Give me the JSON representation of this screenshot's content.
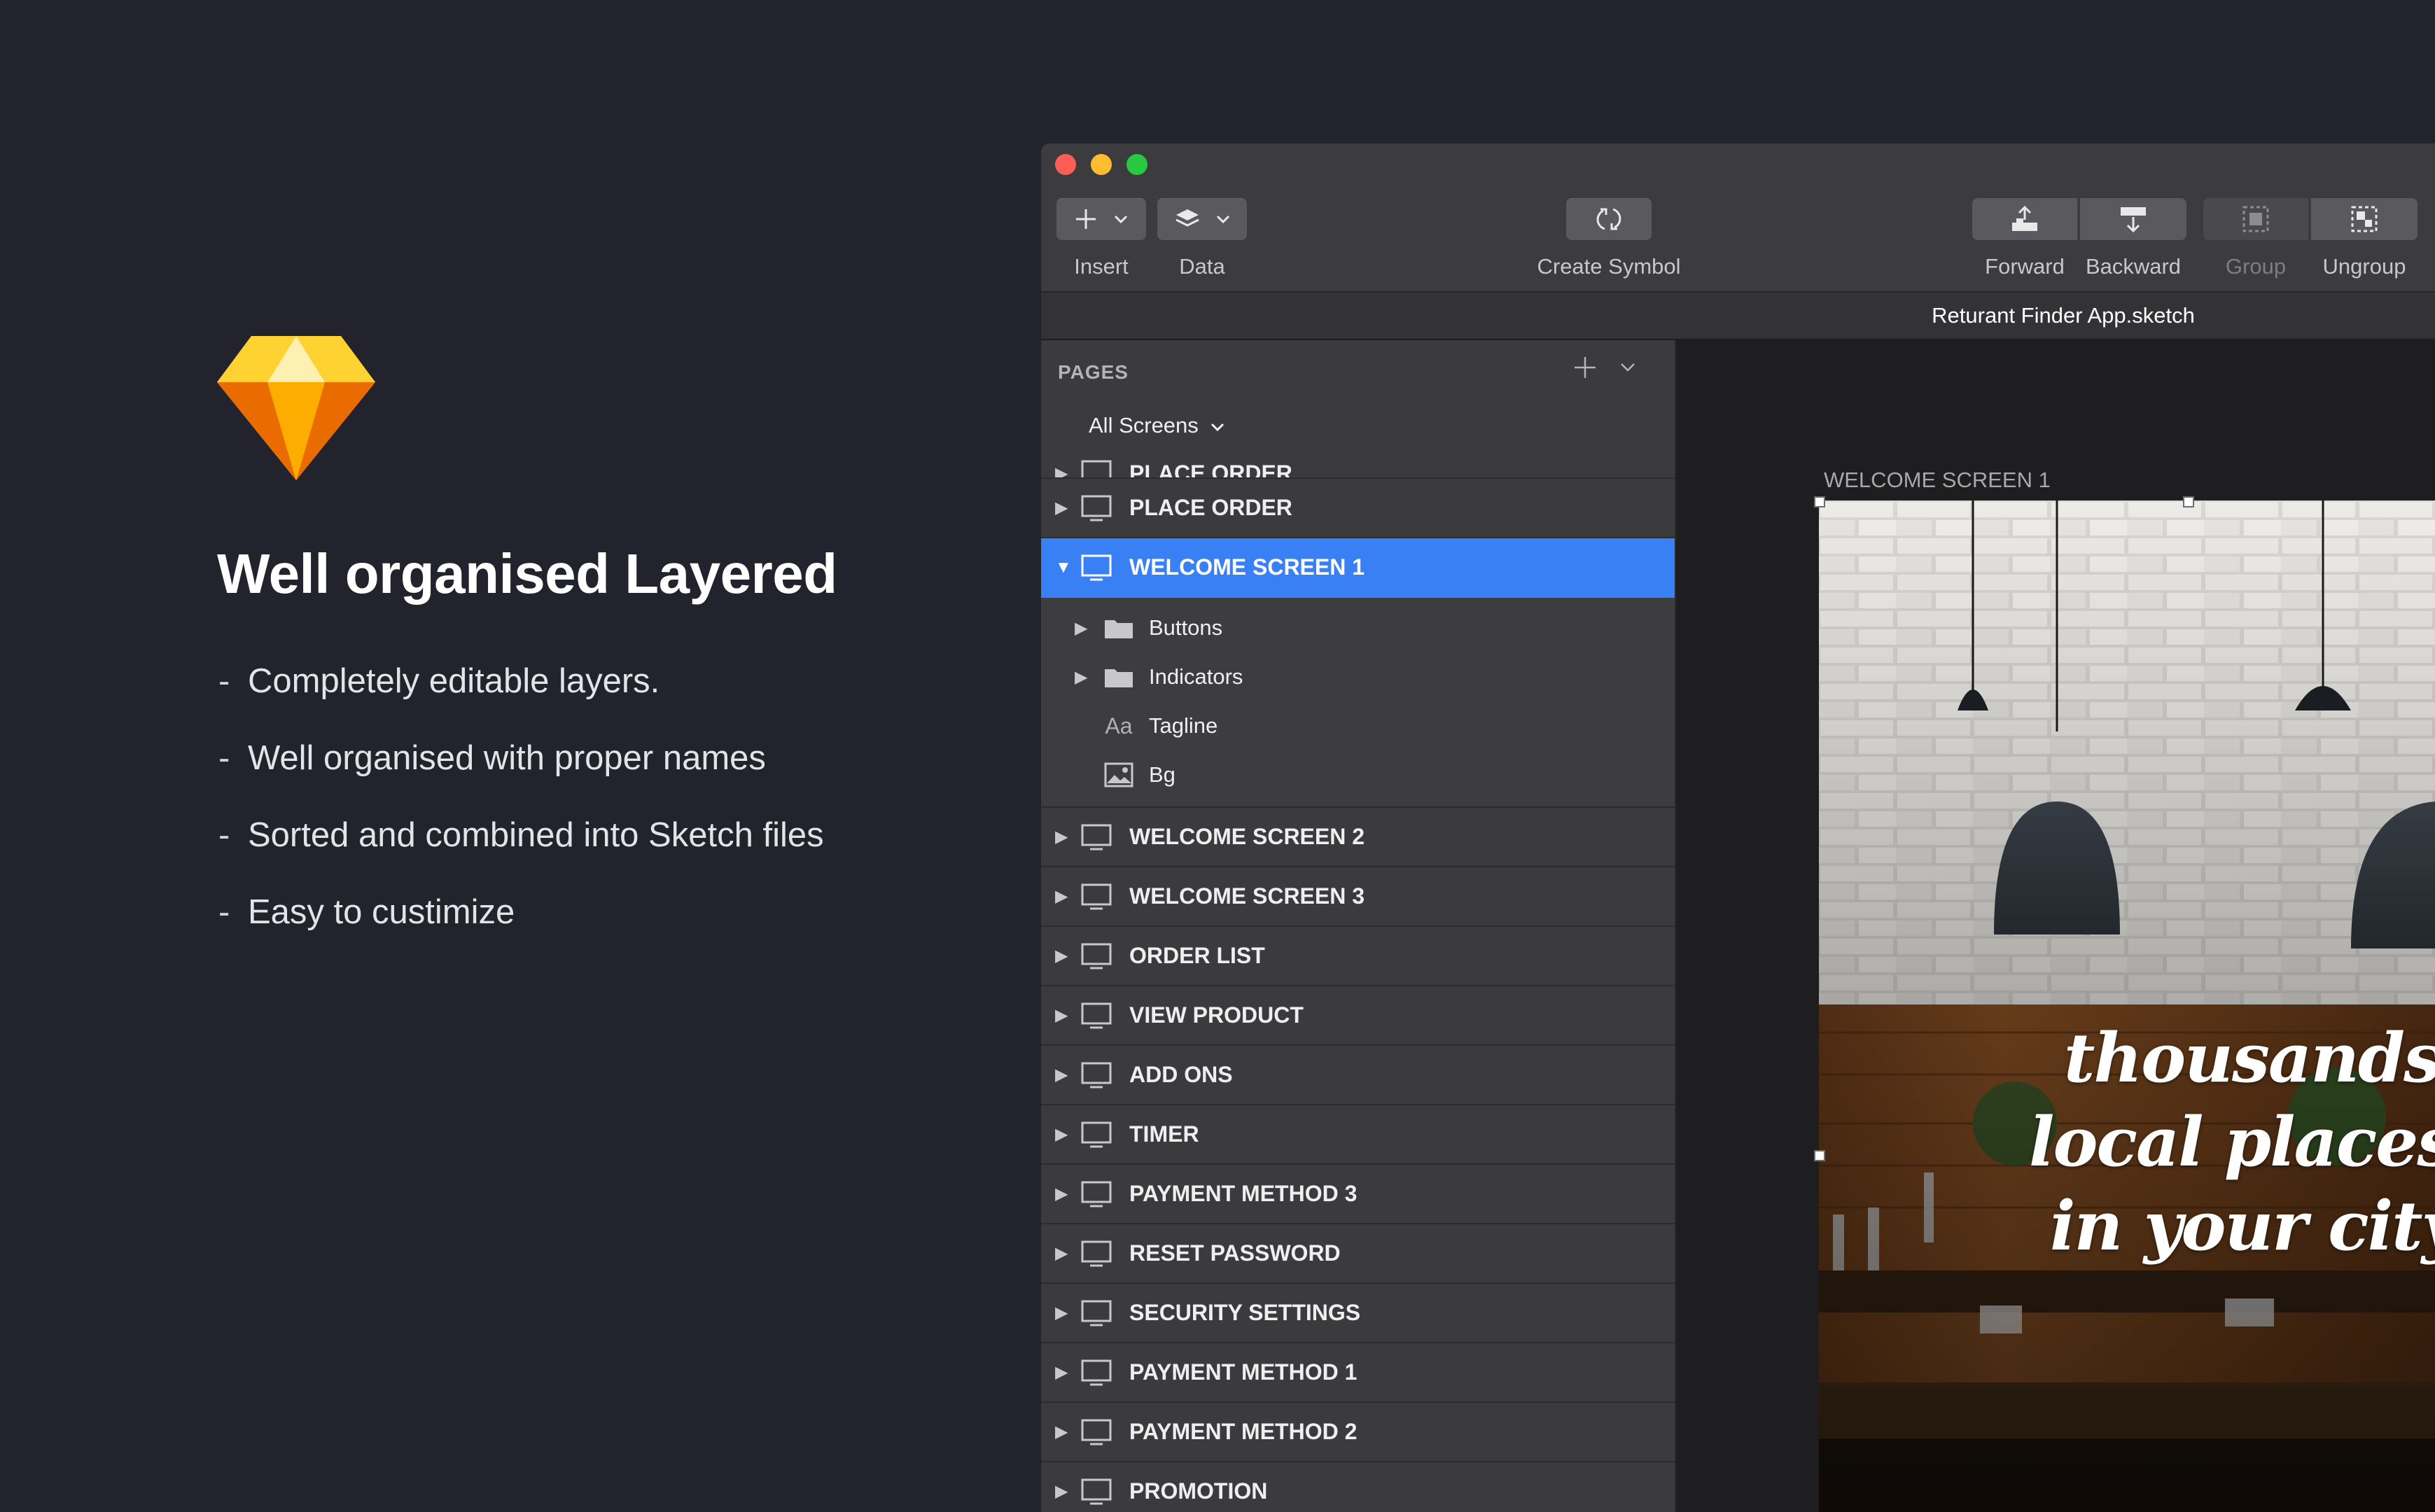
{
  "promo": {
    "headline": "Well organised Layered",
    "features": [
      "Completely editable layers.",
      "Well organised with proper names",
      "Sorted and combined into Sketch files",
      "Easy to custimize"
    ]
  },
  "toolbar": {
    "insert": "Insert",
    "data": "Data",
    "create_symbol": "Create Symbol",
    "forward": "Forward",
    "backward": "Backward",
    "group": "Group",
    "ungroup": "Ungroup"
  },
  "document": {
    "title": "Returant Finder App.sketch"
  },
  "pages_panel": {
    "heading": "PAGES",
    "current_page": "All Screens",
    "partial_row": "PLACE ORDER",
    "rows_before": [
      "PLACE ORDER"
    ],
    "selected": "WELCOME SCREEN 1",
    "children": [
      {
        "label": "Buttons",
        "type": "folder",
        "expandable": true
      },
      {
        "label": "Indicators",
        "type": "folder",
        "expandable": true
      },
      {
        "label": "Tagline",
        "type": "text",
        "expandable": false,
        "icon_text": "Aa"
      },
      {
        "label": "Bg",
        "type": "image",
        "expandable": false
      }
    ],
    "rows_after": [
      "WELCOME SCREEN 2",
      "WELCOME SCREEN 3",
      "ORDER LIST",
      "VIEW PRODUCT",
      "ADD ONS",
      "TIMER",
      "PAYMENT METHOD 3",
      "RESET PASSWORD",
      "SECURITY SETTINGS",
      "PAYMENT METHOD 1",
      "PAYMENT METHOD 2",
      "PROMOTION"
    ]
  },
  "canvas": {
    "artboard_label": "WELCOME SCREEN 1",
    "tagline": [
      "thousands",
      "local places",
      "in your city"
    ]
  },
  "colors": {
    "background": "#23232d",
    "selection": "#3a80f5",
    "traffic_close": "#fd5f57",
    "traffic_min": "#fdbd2e",
    "traffic_max": "#28c840"
  }
}
